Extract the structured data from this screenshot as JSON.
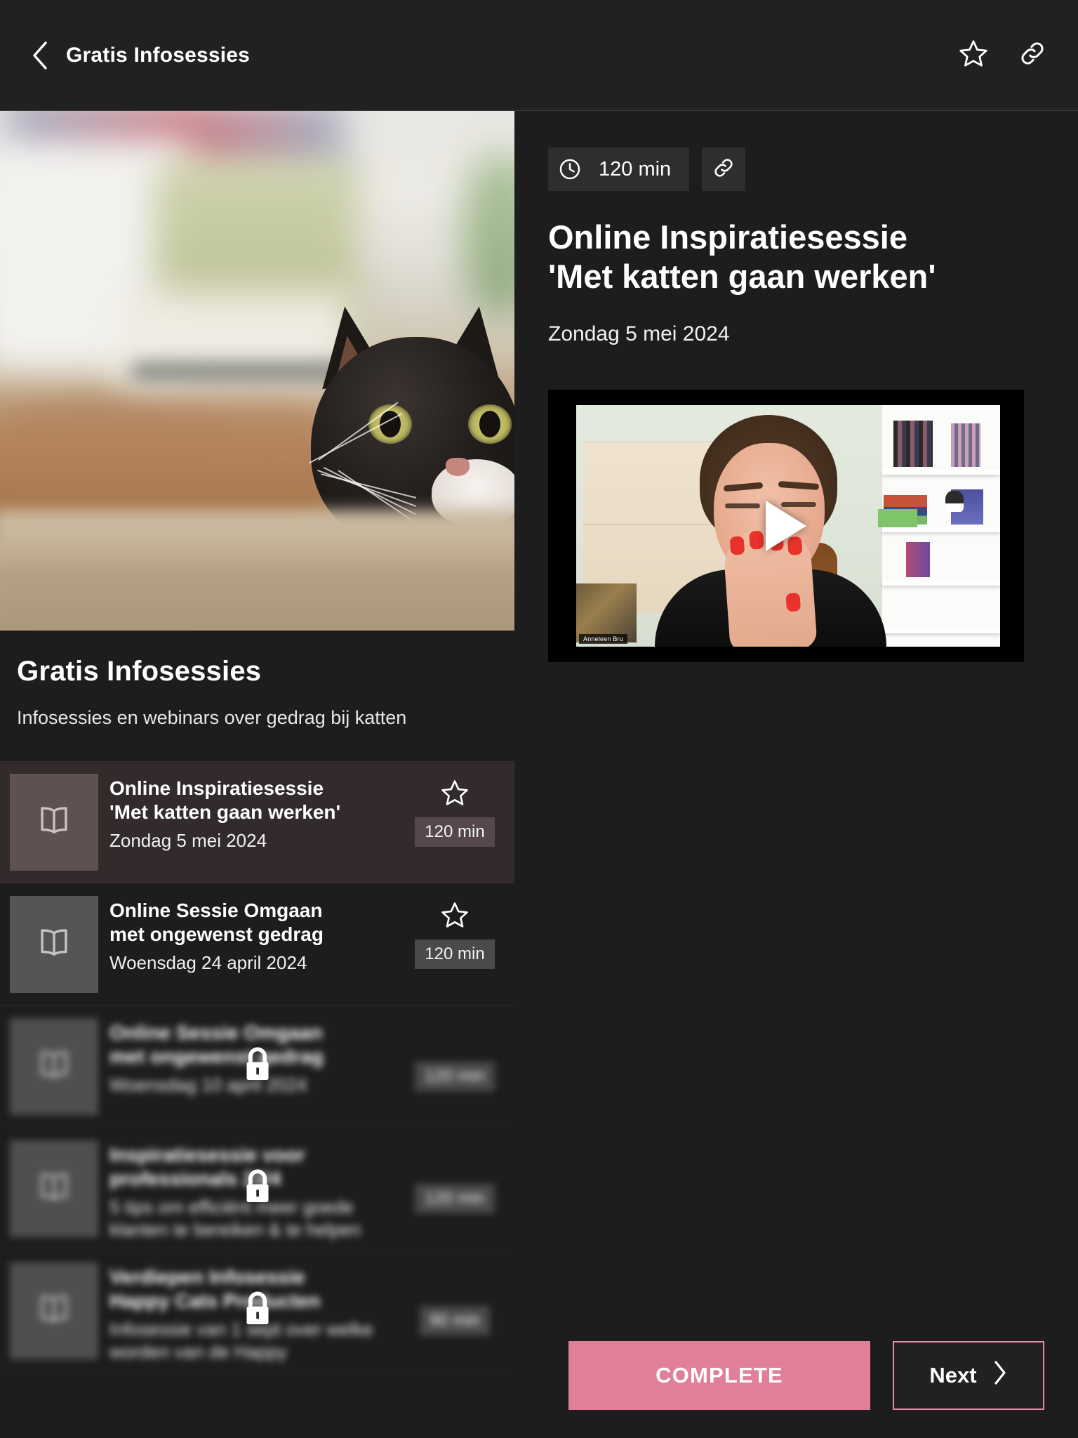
{
  "topbar": {
    "back_icon": "chevron-left-icon",
    "title": "Gratis Infosessies",
    "favorite_icon": "star-outline-icon",
    "share_icon": "link-icon"
  },
  "course": {
    "title": "Gratis Infosessies",
    "subtitle": "Infosessies en webinars over gedrag bij katten",
    "hero_image_alt": "black-and-white-cat-peeking-over-table"
  },
  "lessons": [
    {
      "icon": "book-icon",
      "title_line1": "Online Inspiratiesessie",
      "title_line2": "'Met katten gaan werken'",
      "date": "Zondag 5 mei 2024",
      "duration": "120 min",
      "favorite_icon": "star-outline-icon",
      "active": true,
      "locked": false
    },
    {
      "icon": "book-icon",
      "title_line1": "Online Sessie Omgaan",
      "title_line2": "met ongewenst gedrag",
      "date": "Woensdag 24 april 2024",
      "duration": "120 min",
      "favorite_icon": "star-outline-icon",
      "active": false,
      "locked": false
    },
    {
      "icon": "book-icon",
      "title_line1": "Online Sessie Omgaan",
      "title_line2": "met ongewenst gedrag",
      "date": "Woensdag 10 april 2024",
      "duration": "120 min",
      "favorite_icon": "star-outline-icon",
      "active": false,
      "locked": true,
      "lock_icon": "lock-icon"
    },
    {
      "icon": "book-icon",
      "title_line1": "Inspiratiesessie voor",
      "title_line2": "professionals 23/4",
      "date": "5 tips om efficiënt meer goede klanten te bereiken & te helpen",
      "duration": "120 min",
      "favorite_icon": "star-outline-icon",
      "active": false,
      "locked": true,
      "lock_icon": "lock-icon"
    },
    {
      "icon": "book-icon",
      "title_line1": "Verdiepen Infosessie",
      "title_line2": "Happy Cats Producten",
      "date": "Infosessie van 1 sept over welke worden van de Happy",
      "duration": "90 min",
      "favorite_icon": "star-outline-icon",
      "active": false,
      "locked": true,
      "lock_icon": "lock-icon"
    }
  ],
  "detail": {
    "clock_icon": "clock-icon",
    "duration": "120 min",
    "share_icon": "link-icon",
    "title_line1": "Online Inspiratiesessie",
    "title_line2": "'Met katten gaan werken'",
    "date": "Zondag 5 mei 2024",
    "video": {
      "play_icon": "play-icon",
      "name_label": "Anneleen Bru",
      "thumbnail_alt": "woman-speaking-on-webcam-in-front-of-bookshelf"
    }
  },
  "footer": {
    "complete_label": "COMPLETE",
    "next_label": "Next",
    "next_icon": "chevron-right-icon"
  },
  "colors": {
    "page_bg": "#1d1d1d",
    "topbar_bg": "#212121",
    "active_row_bg": "#332b2b",
    "badge_bg": "#4a4a4a",
    "accent_pink": "#e07f97",
    "next_border": "#e58ba1"
  }
}
